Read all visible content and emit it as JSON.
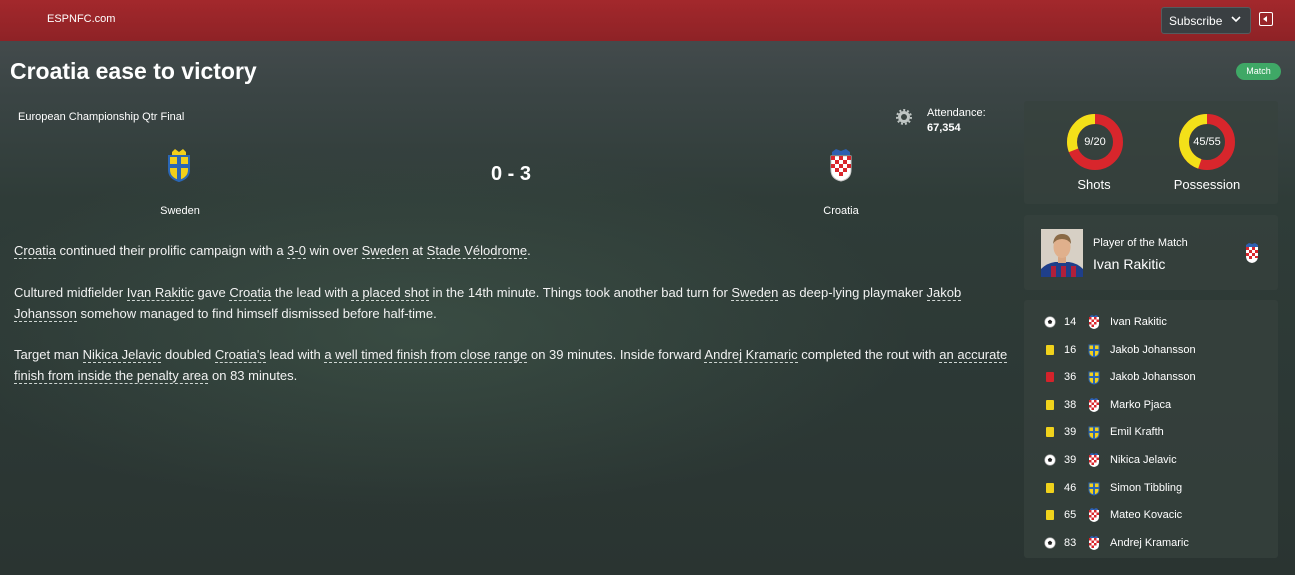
{
  "header": {
    "site": "ESPNFC.com",
    "subscribe_label": "Subscribe"
  },
  "article": {
    "title": "Croatia ease to victory",
    "badge": "Match",
    "competition": "European Championship Qtr Final",
    "attendance_label": "Attendance:",
    "attendance_value": "67,354",
    "home_team": "Sweden",
    "away_team": "Croatia",
    "score": "0 - 3",
    "p1": [
      {
        "t": "Croatia",
        "l": true
      },
      {
        "t": " continued their prolific campaign with a ",
        "l": false
      },
      {
        "t": "3-0",
        "l": true
      },
      {
        "t": " win over ",
        "l": false
      },
      {
        "t": "Sweden",
        "l": true
      },
      {
        "t": " at ",
        "l": false
      },
      {
        "t": "Stade Vélodrome",
        "l": true
      },
      {
        "t": ".",
        "l": false
      }
    ],
    "p2": [
      {
        "t": "Cultured midfielder ",
        "l": false
      },
      {
        "t": "Ivan Rakitic",
        "l": true
      },
      {
        "t": " gave ",
        "l": false
      },
      {
        "t": "Croatia",
        "l": true
      },
      {
        "t": " the lead with ",
        "l": false
      },
      {
        "t": "a placed shot",
        "l": true
      },
      {
        "t": " in the 14th minute. Things took another bad turn for ",
        "l": false
      },
      {
        "t": "Sweden",
        "l": true
      },
      {
        "t": " as deep-lying playmaker ",
        "l": false
      },
      {
        "t": "Jakob Johansson",
        "l": true
      },
      {
        "t": " somehow managed to find himself dismissed before half-time.",
        "l": false
      }
    ],
    "p3": [
      {
        "t": "Target man ",
        "l": false
      },
      {
        "t": "Nikica Jelavic",
        "l": true
      },
      {
        "t": " doubled ",
        "l": false
      },
      {
        "t": "Croatia's",
        "l": true
      },
      {
        "t": " lead with ",
        "l": false
      },
      {
        "t": "a well timed finish from close range",
        "l": true
      },
      {
        "t": " on 39 minutes. Inside forward ",
        "l": false
      },
      {
        "t": "Andrej Kramaric",
        "l": true
      },
      {
        "t": " completed the rout with ",
        "l": false
      },
      {
        "t": "an accurate finish from inside the penalty area",
        "l": true
      },
      {
        "t": " on 83 minutes.",
        "l": false
      }
    ]
  },
  "stats": [
    {
      "label": "Shots",
      "value": "9/20",
      "home_share": 0.31
    },
    {
      "label": "Possession",
      "value": "45/55",
      "home_share": 0.45
    }
  ],
  "stat_colors": {
    "home": "#f3e019",
    "away": "#d8262c"
  },
  "potm": {
    "label": "Player of the Match",
    "name": "Ivan Rakitic"
  },
  "events": [
    {
      "type": "goal",
      "minute": "14",
      "team": "croatia",
      "player": "Ivan Rakitic"
    },
    {
      "type": "yellow",
      "minute": "16",
      "team": "sweden",
      "player": "Jakob Johansson"
    },
    {
      "type": "red",
      "minute": "36",
      "team": "sweden",
      "player": "Jakob Johansson"
    },
    {
      "type": "yellow",
      "minute": "38",
      "team": "croatia",
      "player": "Marko Pjaca"
    },
    {
      "type": "yellow",
      "minute": "39",
      "team": "sweden",
      "player": "Emil Krafth"
    },
    {
      "type": "goal",
      "minute": "39",
      "team": "croatia",
      "player": "Nikica Jelavic"
    },
    {
      "type": "yellow",
      "minute": "46",
      "team": "sweden",
      "player": "Simon Tibbling"
    },
    {
      "type": "yellow",
      "minute": "65",
      "team": "croatia",
      "player": "Mateo Kovacic"
    },
    {
      "type": "goal",
      "minute": "83",
      "team": "croatia",
      "player": "Andrej Kramaric"
    }
  ]
}
